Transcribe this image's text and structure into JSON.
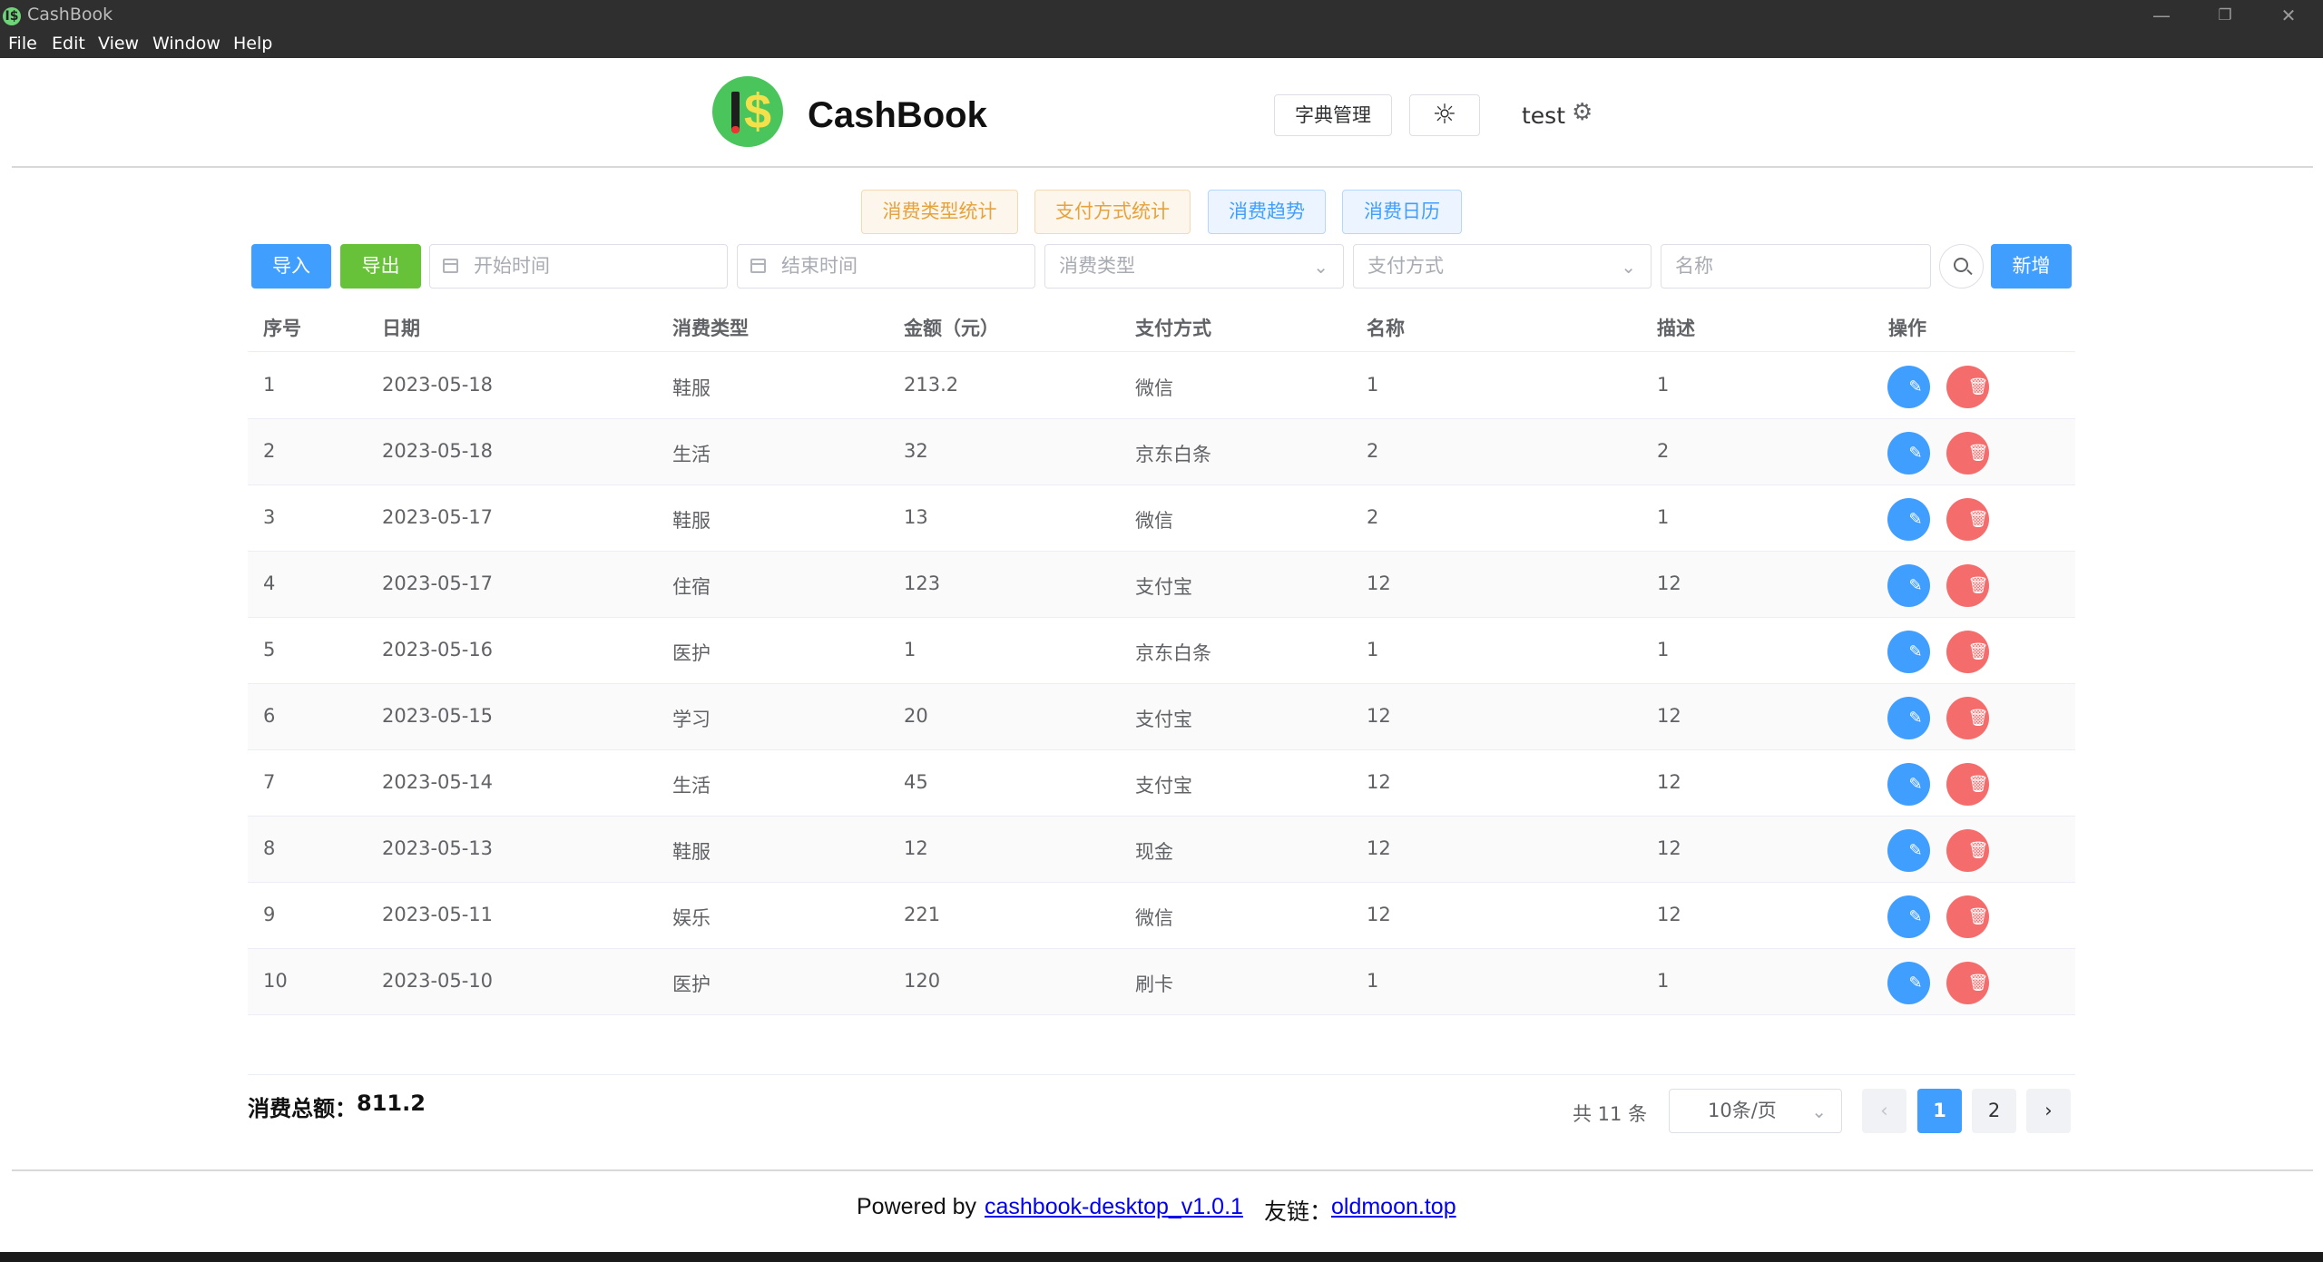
{
  "window": {
    "title": "CashBook",
    "app_icon_glyph": "I$",
    "controls": [
      "—",
      "❐",
      "✕"
    ]
  },
  "menu": [
    "File",
    "Edit",
    "View",
    "Window",
    "Help"
  ],
  "header": {
    "brand": "CashBook",
    "dict_button": "字典管理",
    "theme_icon": "☼",
    "username": "test",
    "settings_icon": "⚙"
  },
  "stats_tabs": [
    "消费类型统计",
    "支付方式统计",
    "消费趋势",
    "消费日历"
  ],
  "toolbar": {
    "import_label": "导入",
    "export_label": "导出",
    "start_placeholder": "开始时间",
    "end_placeholder": "结束时间",
    "type_placeholder": "消费类型",
    "pay_placeholder": "支付方式",
    "name_placeholder": "名称",
    "add_label": "新增"
  },
  "table": {
    "columns": [
      "序号",
      "日期",
      "消费类型",
      "金额（元）",
      "支付方式",
      "名称",
      "描述",
      "操作"
    ],
    "rows": [
      [
        "1",
        "2023-05-18",
        "鞋服",
        "213.2",
        "微信",
        "1",
        "1"
      ],
      [
        "2",
        "2023-05-18",
        "生活",
        "32",
        "京东白条",
        "2",
        "2"
      ],
      [
        "3",
        "2023-05-17",
        "鞋服",
        "13",
        "微信",
        "2",
        "1"
      ],
      [
        "4",
        "2023-05-17",
        "住宿",
        "123",
        "支付宝",
        "12",
        "12"
      ],
      [
        "5",
        "2023-05-16",
        "医护",
        "1",
        "京东白条",
        "1",
        "1"
      ],
      [
        "6",
        "2023-05-15",
        "学习",
        "20",
        "支付宝",
        "12",
        "12"
      ],
      [
        "7",
        "2023-05-14",
        "生活",
        "45",
        "支付宝",
        "12",
        "12"
      ],
      [
        "8",
        "2023-05-13",
        "鞋服",
        "12",
        "现金",
        "12",
        "12"
      ],
      [
        "9",
        "2023-05-11",
        "娱乐",
        "221",
        "微信",
        "12",
        "12"
      ],
      [
        "10",
        "2023-05-10",
        "医护",
        "120",
        "刷卡",
        "1",
        "1"
      ]
    ],
    "edit_icon": "✎",
    "delete_icon": "🗑"
  },
  "summary": {
    "label": "消费总额：",
    "value": "811.2"
  },
  "pagination": {
    "total": "共 11 条",
    "page_size": "10条/页",
    "prev": "‹",
    "next": "›",
    "pages": [
      "1",
      "2"
    ],
    "current": "1"
  },
  "footer": {
    "powered_prefix": "Powered by",
    "project_link": "cashbook-desktop_v1.0.1",
    "friends_label": "友链：",
    "friend_link": "oldmoon.top"
  },
  "colors": {
    "primary": "#409eff",
    "success": "#67c23a",
    "danger": "#f56c6c",
    "warning": "#e6a23c"
  }
}
